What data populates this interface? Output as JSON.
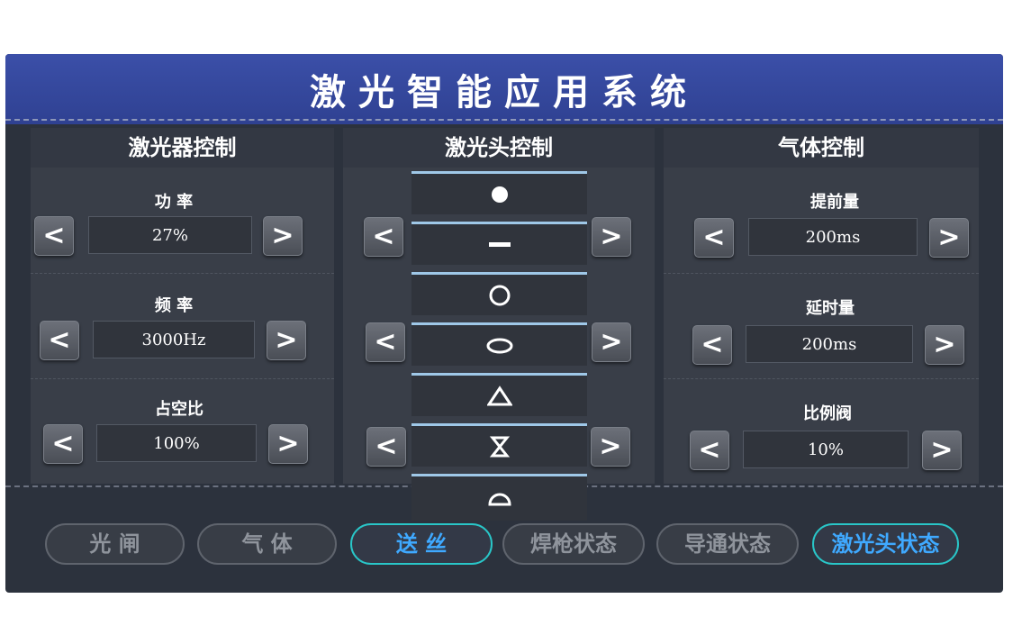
{
  "app": {
    "title": "激光智能应用系统"
  },
  "laser": {
    "header": "激光器控制",
    "power": {
      "label": "功 率",
      "value": "27%"
    },
    "frequency": {
      "label": "频 率",
      "value": "3000Hz"
    },
    "duty": {
      "label": "占空比",
      "value": "100%"
    }
  },
  "head": {
    "header": "激光头控制",
    "modes": [
      "dot",
      "line",
      "circle",
      "ellipse",
      "triangle",
      "hourglass",
      "semicircle"
    ]
  },
  "gas": {
    "header": "气体控制",
    "advance": {
      "label": "提前量",
      "value": "200ms"
    },
    "delay": {
      "label": "延时量",
      "value": "200ms"
    },
    "valve": {
      "label": "比例阀",
      "value": "10%"
    }
  },
  "arrows": {
    "left": "<",
    "right": ">"
  },
  "bottom": {
    "shutter": "光 闸",
    "gas": "气 体",
    "wire_feed": "送 丝",
    "torch_status": "焊枪状态",
    "conduct_status": "导通状态",
    "head_status": "激光头状态"
  },
  "colors": {
    "titlebar": "#3b4fa8",
    "panel": "#2c323d",
    "active_border": "#29c6c8",
    "active_text": "#3fa9ff"
  }
}
